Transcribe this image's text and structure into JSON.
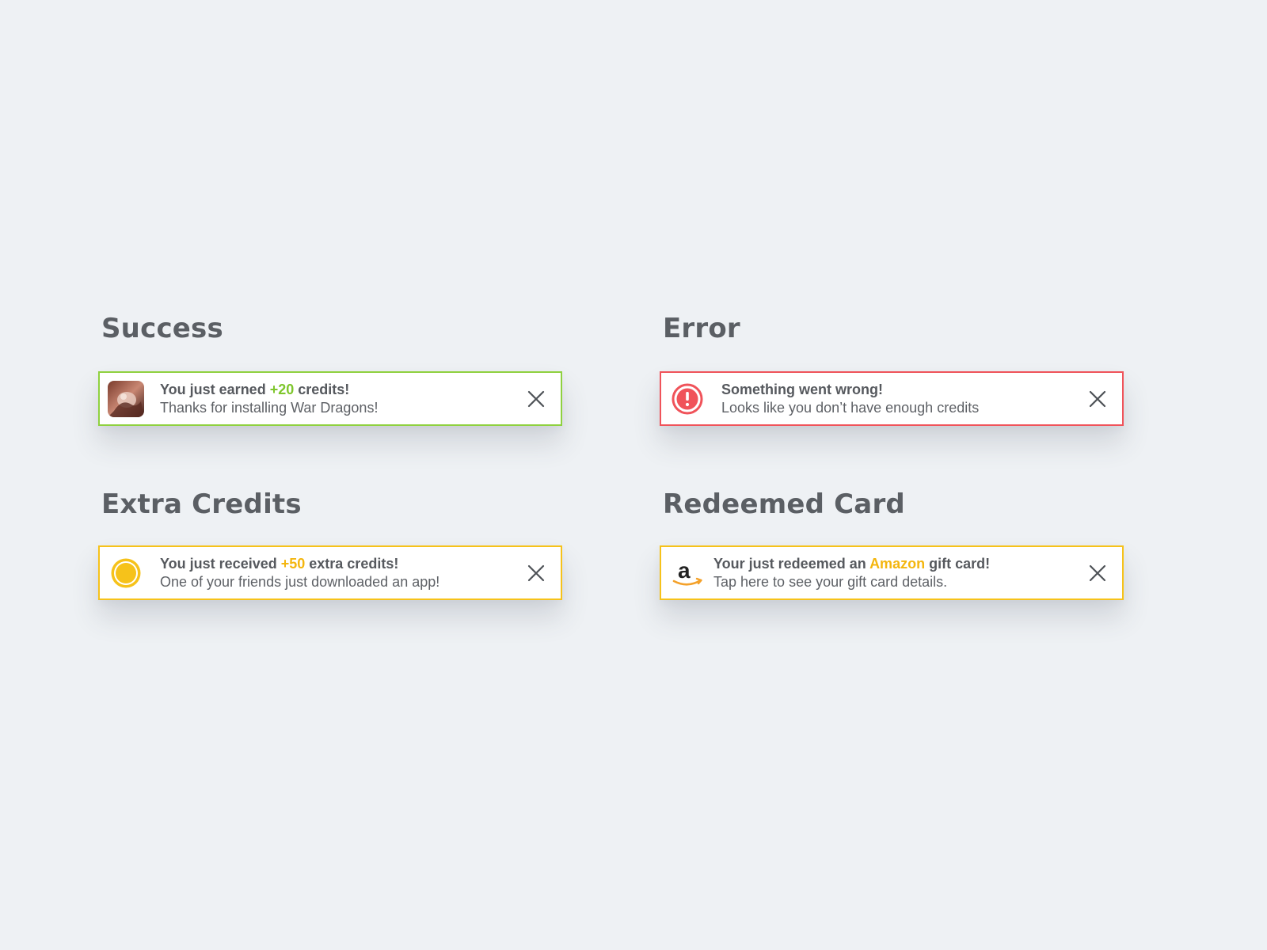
{
  "colors": {
    "background": "#eef1f4",
    "success": "#8fd13f",
    "error": "#f0535a",
    "warning": "#f6c21a",
    "highlight_green": "#7ec62c",
    "highlight_yellow": "#f4b60f"
  },
  "success": {
    "title": "Success",
    "icon": "app-thumbnail",
    "line1_prefix": "You just earned ",
    "line1_highlight": "+20",
    "line1_suffix": " credits!",
    "line2": "Thanks for installing War Dragons!",
    "close_icon": "close-icon"
  },
  "error": {
    "title": "Error",
    "icon": "exclamation-circle-icon",
    "line1": "Something went wrong!",
    "line2": "Looks like you don’t have enough credits",
    "close_icon": "close-icon"
  },
  "extra_credits": {
    "title": "Extra Credits",
    "icon": "coin-icon",
    "line1_prefix": "You just received ",
    "line1_highlight": "+50",
    "line1_suffix": " extra credits!",
    "line2": "One of your friends just downloaded an app!",
    "close_icon": "close-icon"
  },
  "redeemed_card": {
    "title": "Redeemed Card",
    "icon": "amazon-logo-icon",
    "line1_prefix": "Your just redeemed an ",
    "line1_highlight": "Amazon",
    "line1_suffix": " gift card!",
    "line2": "Tap here to see your gift card details.",
    "close_icon": "close-icon"
  }
}
